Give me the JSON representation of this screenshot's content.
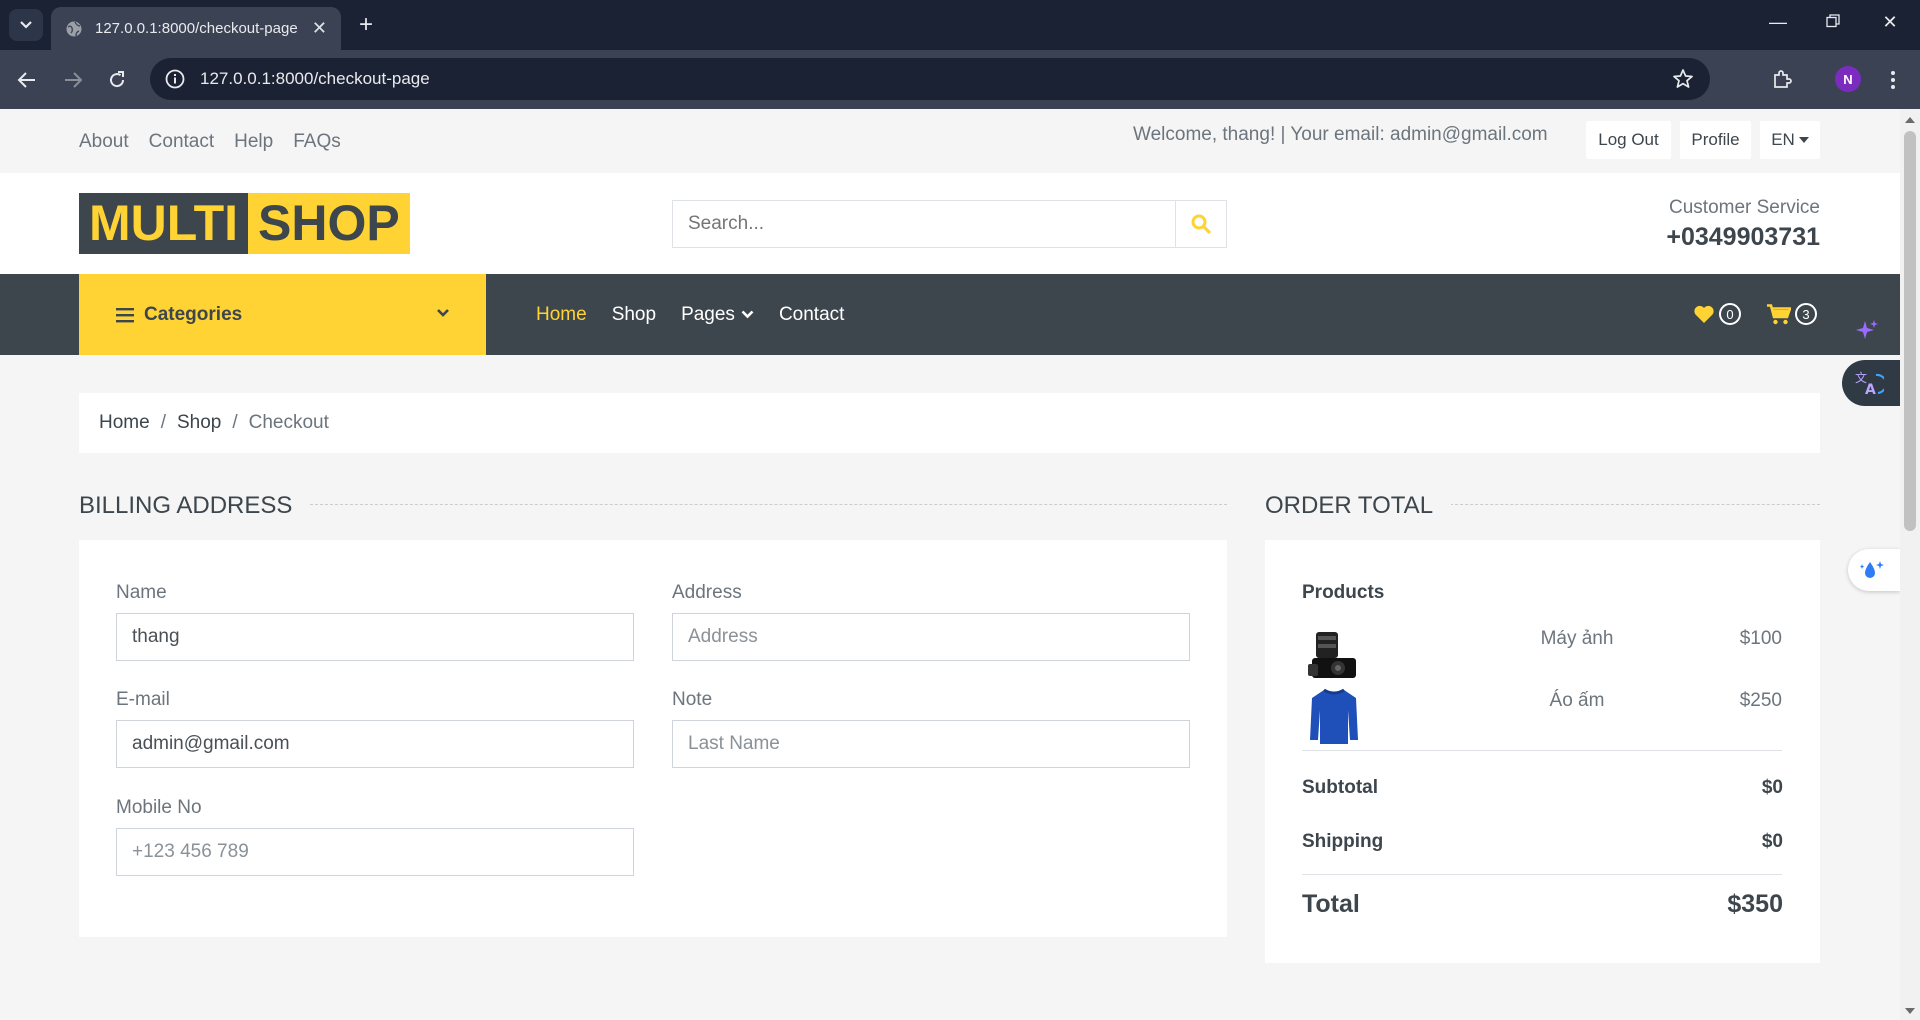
{
  "browser": {
    "tab_title": "127.0.0.1:8000/checkout-page",
    "url": "127.0.0.1:8000/checkout-page",
    "profile_initial": "N"
  },
  "topbar": {
    "links": [
      "About",
      "Contact",
      "Help",
      "FAQs"
    ],
    "welcome": "Welcome, thang! | Your email: admin@gmail.com",
    "logout": "Log Out",
    "profile": "Profile",
    "language": "EN"
  },
  "header": {
    "logo_part1": "MULTI",
    "logo_part2": "SHOP",
    "search_placeholder": "Search...",
    "cs_label": "Customer Service",
    "cs_phone": "+0349903731"
  },
  "navbar": {
    "categories": "Categories",
    "menu": {
      "home": "Home",
      "shop": "Shop",
      "pages": "Pages",
      "contact": "Contact"
    },
    "wishlist_count": "0",
    "cart_count": "3"
  },
  "breadcrumb": {
    "home": "Home",
    "shop": "Shop",
    "current": "Checkout"
  },
  "billing": {
    "title": "Billing Address",
    "name_label": "Name",
    "name_value": "thang",
    "address_label": "Address",
    "address_placeholder": "Address",
    "email_label": "E-mail",
    "email_value": "admin@gmail.com",
    "note_label": "Note",
    "note_placeholder": "Last Name",
    "mobile_label": "Mobile No",
    "mobile_placeholder": "+123 456 789"
  },
  "order": {
    "title": "Order Total",
    "products_header": "Products",
    "items": [
      {
        "name": "Máy ảnh",
        "price": "$100",
        "image": "camera-image"
      },
      {
        "name": "Áo ấm",
        "price": "$250",
        "image": "sweater-image"
      }
    ],
    "subtotal_label": "Subtotal",
    "subtotal_value": "$0",
    "shipping_label": "Shipping",
    "shipping_value": "$0",
    "total_label": "Total",
    "total_value": "$350"
  },
  "colors": {
    "accent": "#ffd333",
    "dark": "#3d464d",
    "browser_dark": "#1b2234",
    "browser_mid": "#3a4254"
  }
}
